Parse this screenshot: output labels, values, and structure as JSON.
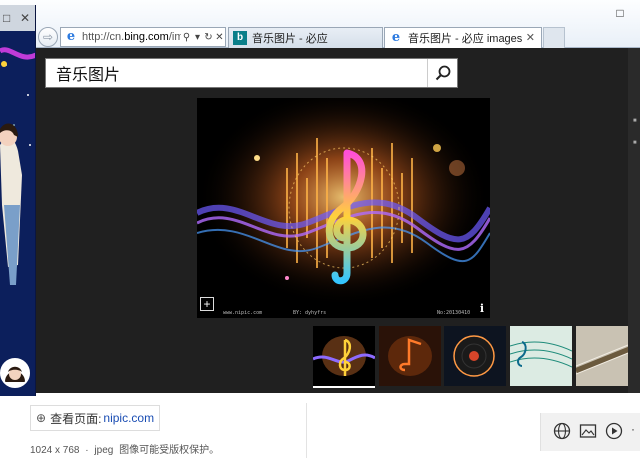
{
  "browser": {
    "address_url_prefix": "http://cn.",
    "address_url_domain": "bing.com",
    "address_url_rest": "/ima",
    "tabs": [
      {
        "label": "音乐图片 - 必应",
        "icon": "bing-icon"
      },
      {
        "label": "音乐图片 - 必应 images",
        "icon": "ie-icon",
        "close": "✕"
      }
    ],
    "close_glyph": "✕",
    "minimize_glyph": "□"
  },
  "search": {
    "query": "音乐图片",
    "button_icon": "search-icon"
  },
  "main_image": {
    "watermark_left": "www.nipic.com",
    "watermark_mid": "BY: dyhyfrs",
    "watermark_right": "No:20130410",
    "info_glyph": "i",
    "expand_glyph": "+"
  },
  "thumbnails": [
    {
      "name": "thumb-treble-clef",
      "selected": true
    },
    {
      "name": "thumb-music-note",
      "selected": false
    },
    {
      "name": "thumb-vinyl-record",
      "selected": false
    },
    {
      "name": "thumb-sheet-music",
      "selected": false
    },
    {
      "name": "thumb-guitar",
      "selected": false
    }
  ],
  "details": {
    "view_page_label": "查看页面:",
    "domain": "nipic.com",
    "dimensions": "1024 x 768",
    "separator": "·",
    "format": "jpeg",
    "copyright_note": "图像可能受版权保护。"
  },
  "colors": {
    "page_bg": "#202020",
    "link": "#1a4db3",
    "widget_bg": "#0c1f5c"
  }
}
